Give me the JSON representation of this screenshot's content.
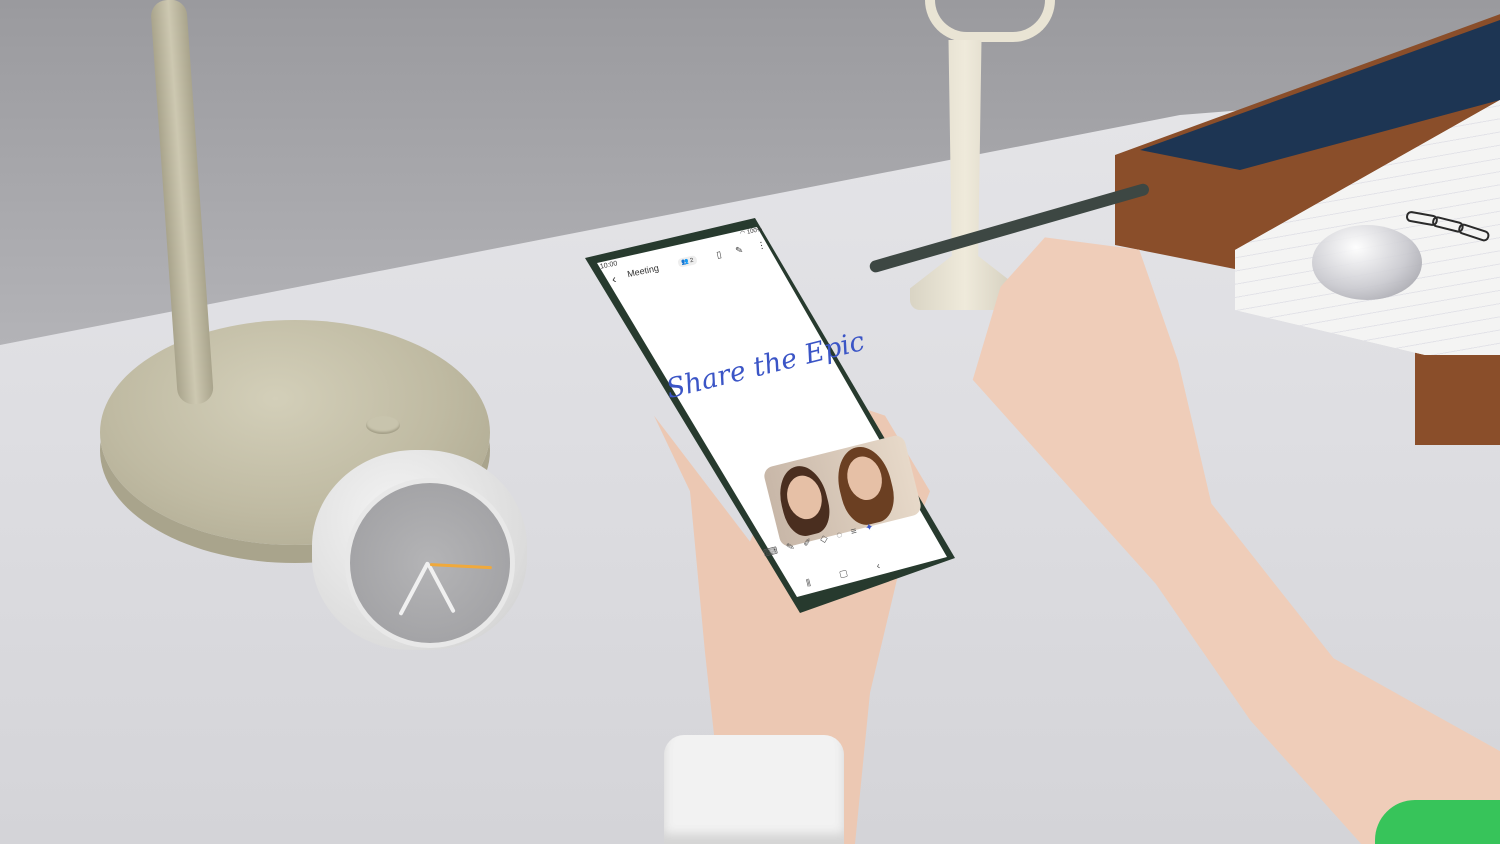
{
  "colors": {
    "handwriting": "#3b55c6",
    "phone_frame": "#273a2e",
    "tray_wood": "#8a4e2a",
    "clock_hand_accent": "#f0a93b",
    "sleeve": "#37c45a"
  },
  "phone": {
    "status_bar": {
      "time": "10:00",
      "battery": "100%"
    },
    "note": {
      "title": "Meeting",
      "collaborators": "2",
      "handwriting": "Share the Epic"
    },
    "icons": {
      "back": "back-arrow-icon",
      "collaborators": "people-icon",
      "book": "book-icon",
      "pen": "pen-icon",
      "more": "more-vertical-icon"
    },
    "pen_tools": [
      "keyboard-icon",
      "pen-icon",
      "highlighter-icon",
      "eraser-icon",
      "lasso-icon",
      "text-format-icon",
      "ai-icon"
    ],
    "nav": [
      "recent-apps-icon",
      "home-icon",
      "back-icon"
    ]
  }
}
